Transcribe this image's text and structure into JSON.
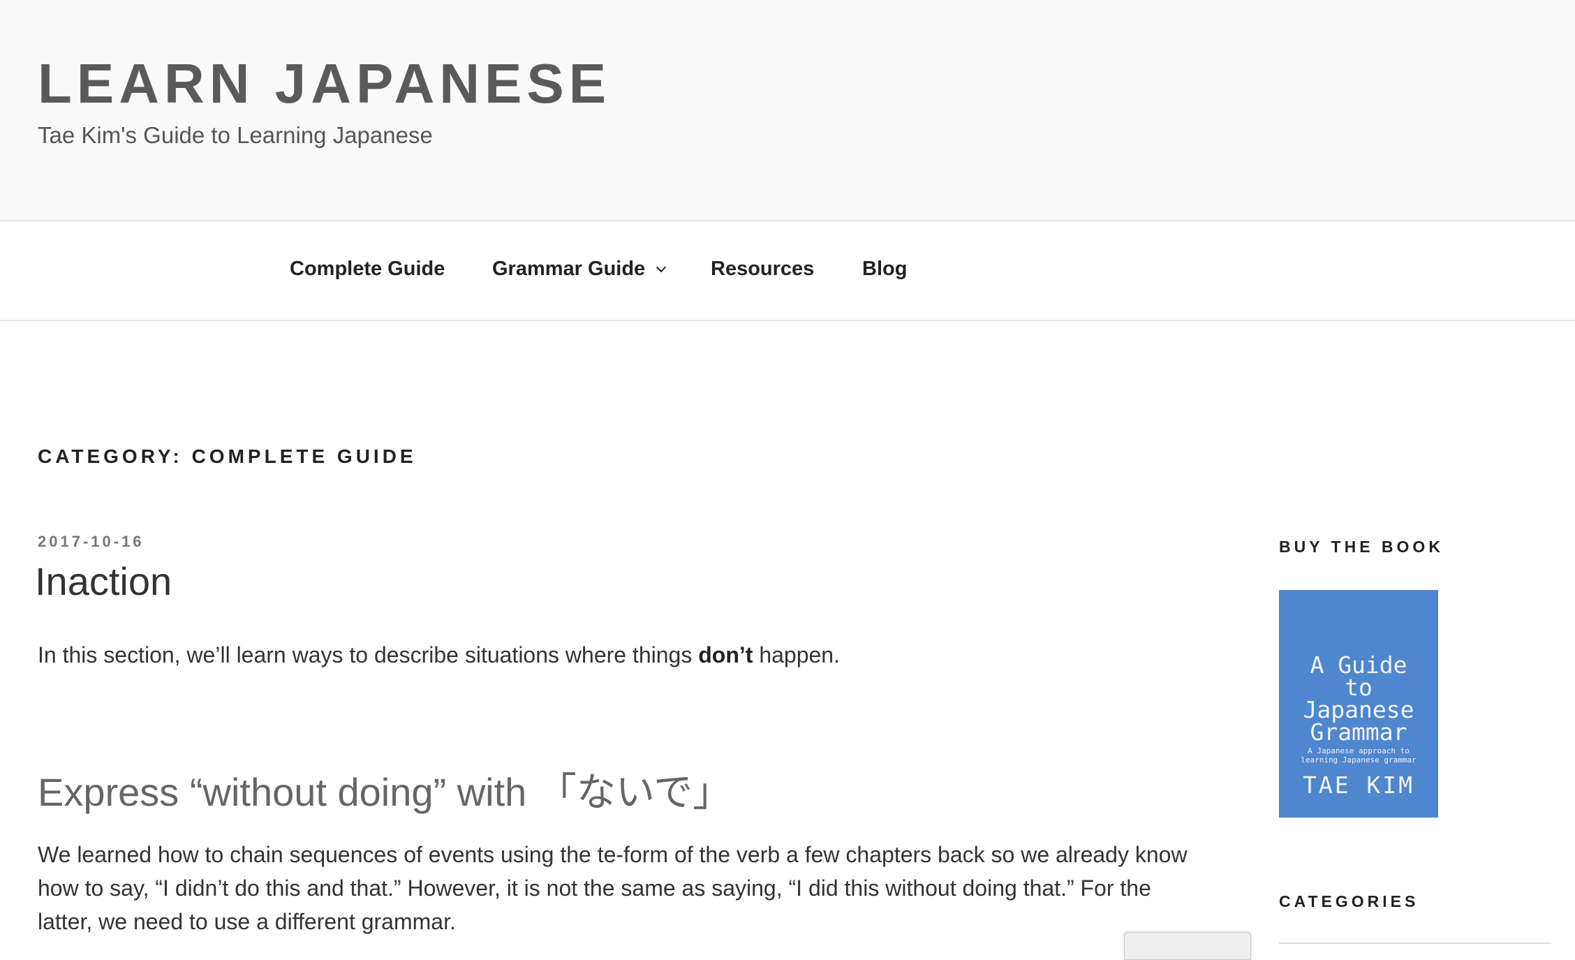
{
  "site": {
    "title": "LEARN JAPANESE",
    "description": "Tae Kim's Guide to Learning Japanese"
  },
  "nav": {
    "items": [
      {
        "label": "Complete Guide"
      },
      {
        "label": "Grammar Guide",
        "has_submenu": true
      },
      {
        "label": "Resources"
      },
      {
        "label": "Blog"
      }
    ]
  },
  "archive": {
    "title": "CATEGORY: COMPLETE GUIDE"
  },
  "post": {
    "date": "2017-10-16",
    "title": "Inaction",
    "intro_before": "In this section, we’ll learn ways to describe situations where things ",
    "intro_bold": "don’t",
    "intro_after": " happen.",
    "heading": "Express “without doing” with 「ないで」",
    "paragraph": "We learned how to chain sequences of events using the te-form of the verb a few chapters back so we already know how to say, “I didn’t do this and that.” However, it is not the same as saying, “I did this without doing that.” For the latter, we need to use a different grammar."
  },
  "sidebar": {
    "buy_title": "BUY THE BOOK",
    "book": {
      "title_lines": [
        "A Guide",
        "to",
        "Japanese",
        "Grammar"
      ],
      "subtitle_lines": [
        "A Japanese approach to",
        "learning Japanese grammar"
      ],
      "author": "TAE KIM"
    },
    "categories_title": "CATEGORIES"
  },
  "colors": {
    "header_bg": "#fafafa",
    "site_title": "#5a5a5a",
    "book_cover": "#4e86cf"
  }
}
